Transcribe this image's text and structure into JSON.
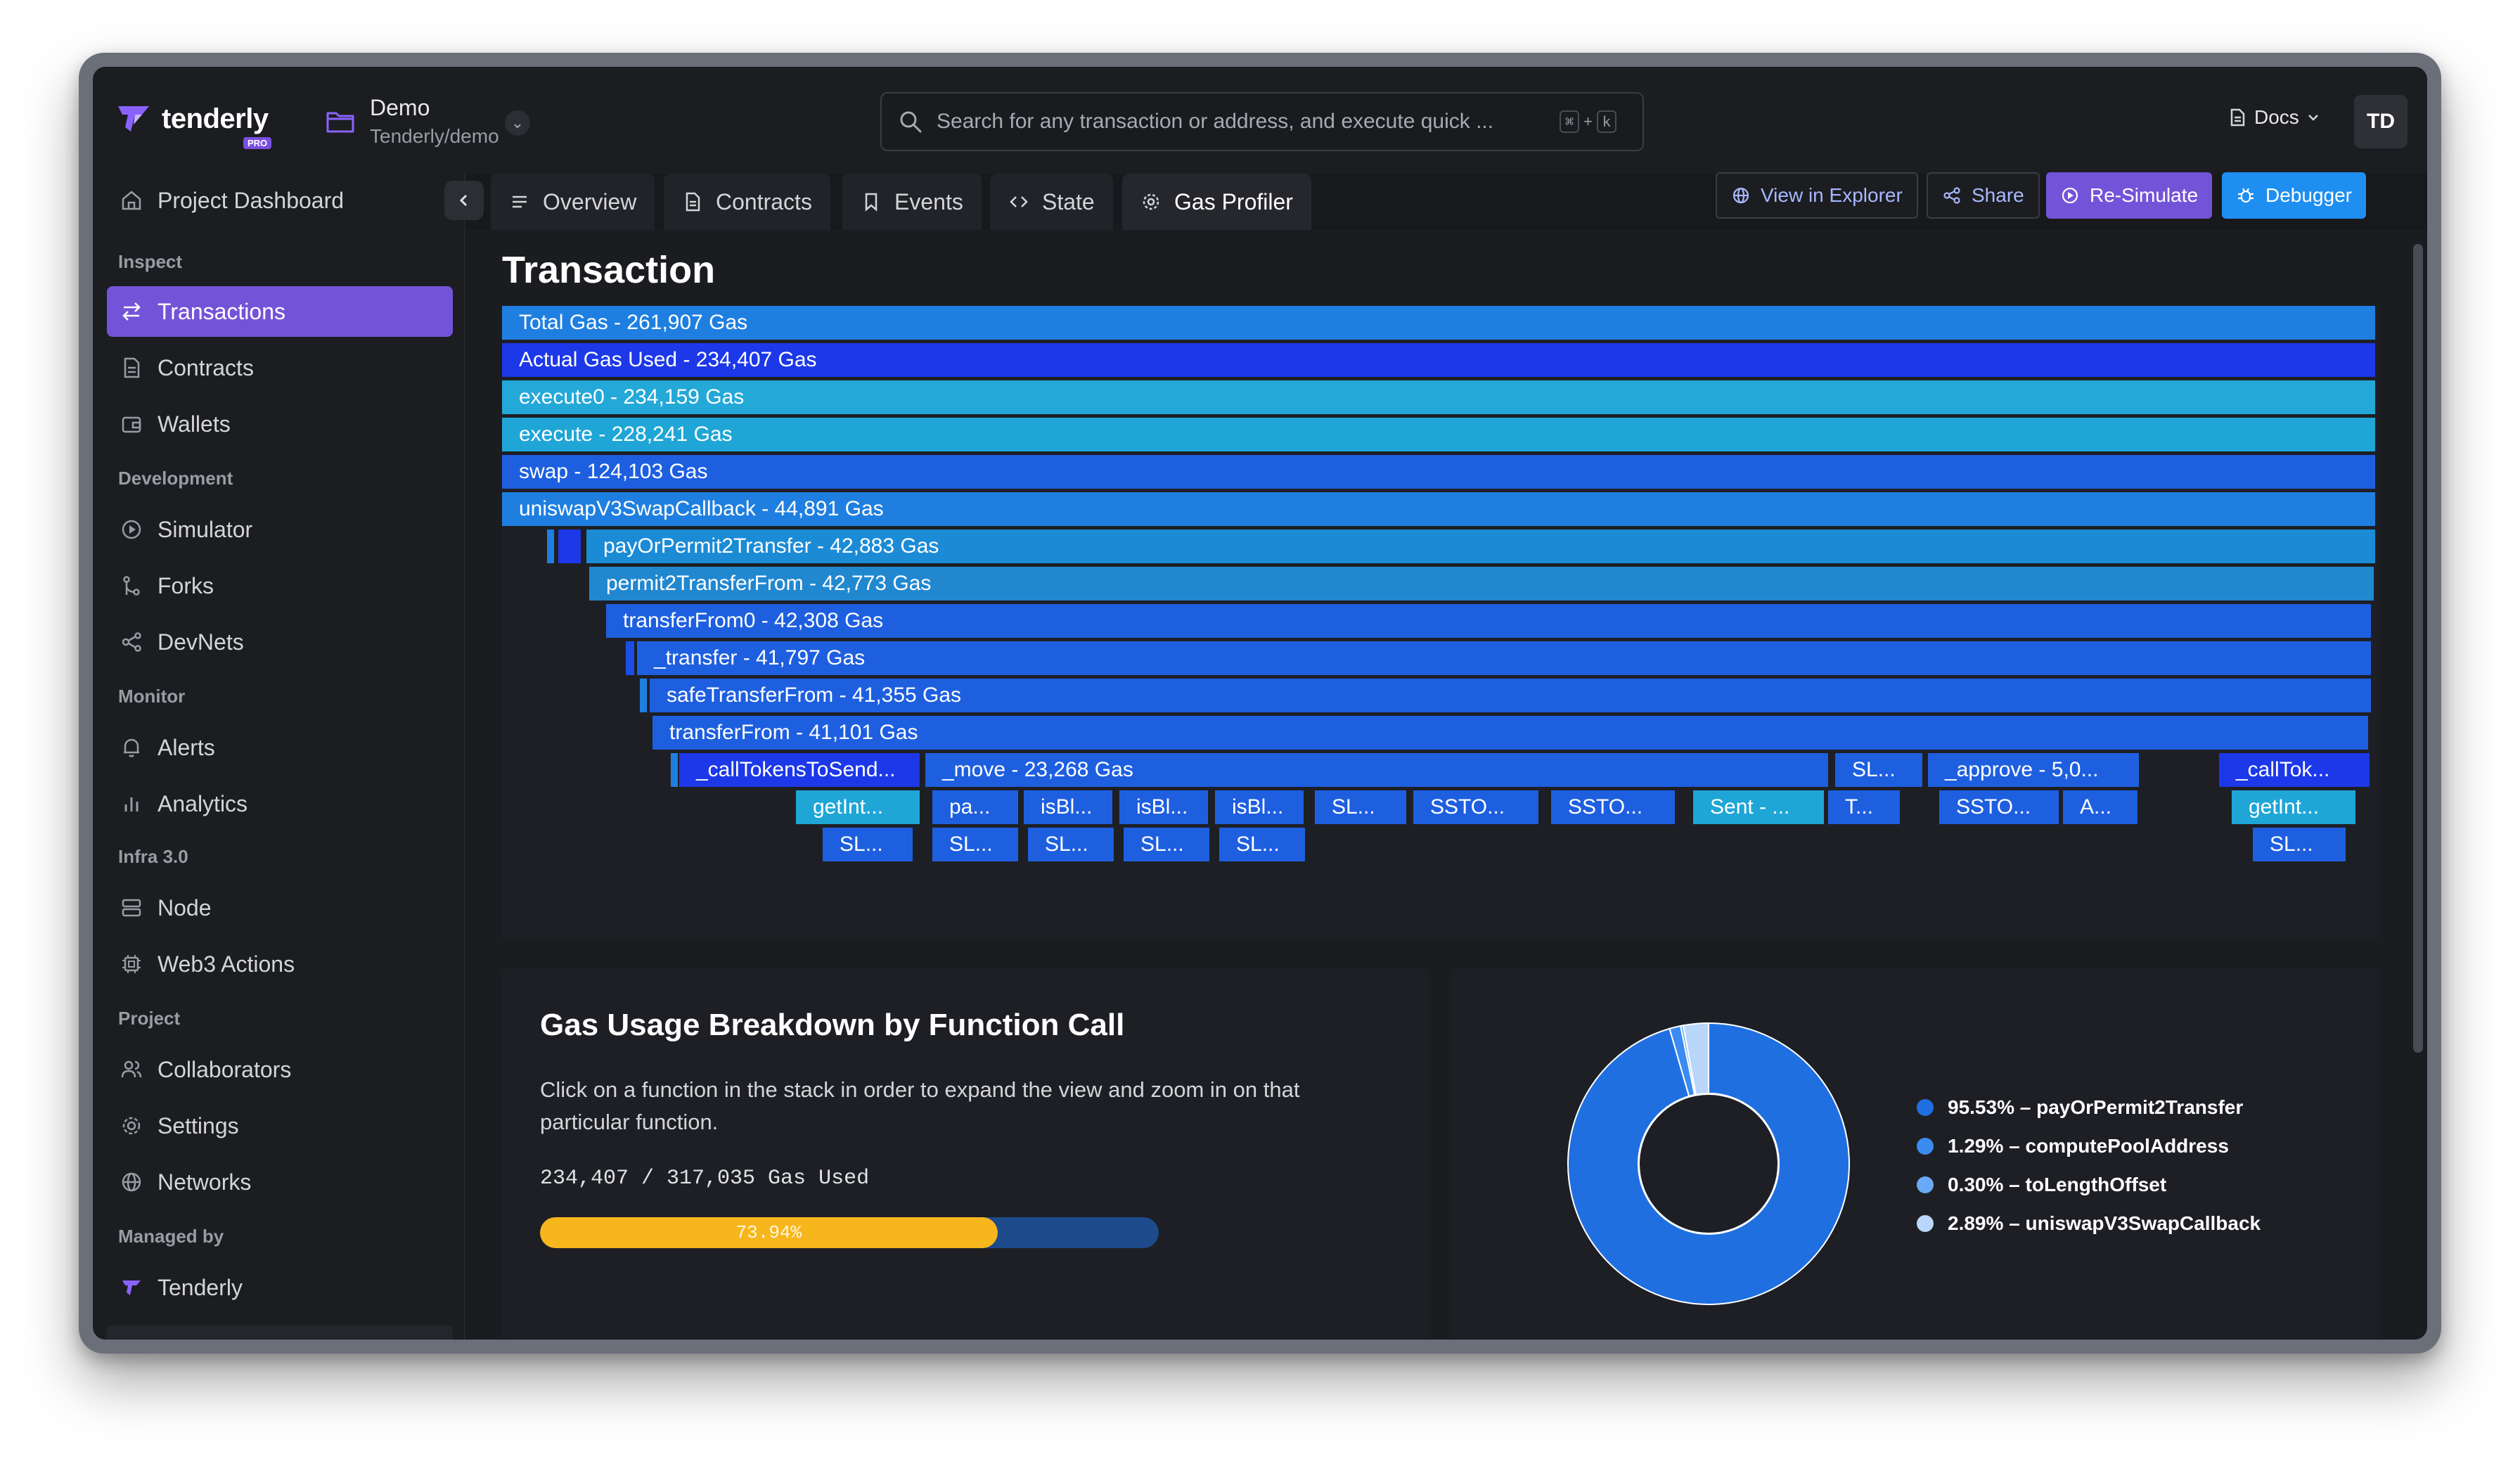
{
  "brand": {
    "name": "tenderly",
    "badge": "PRO"
  },
  "project": {
    "name": "Demo",
    "slug": "Tenderly/demo"
  },
  "search": {
    "placeholder": "Search for any transaction or address, and execute quick ...",
    "shortcut_mod": "⌘",
    "shortcut_plus": "+",
    "shortcut_key": "k"
  },
  "header": {
    "docs_label": "Docs",
    "avatar_initials": "TD"
  },
  "sidebar": {
    "dashboard": "Project Dashboard",
    "sections": {
      "inspect": "Inspect",
      "development": "Development",
      "monitor": "Monitor",
      "infra": "Infra 3.0",
      "project": "Project",
      "managed": "Managed by"
    },
    "items": {
      "transactions": "Transactions",
      "contracts": "Contracts",
      "wallets": "Wallets",
      "simulator": "Simulator",
      "forks": "Forks",
      "devnets": "DevNets",
      "alerts": "Alerts",
      "analytics": "Analytics",
      "node": "Node",
      "web3_actions": "Web3 Actions",
      "collaborators": "Collaborators",
      "settings": "Settings",
      "networks": "Networks",
      "tenderly": "Tenderly"
    }
  },
  "tabs": {
    "overview": "Overview",
    "contracts": "Contracts",
    "events": "Events",
    "state": "State",
    "gas_profiler": "Gas Profiler"
  },
  "actions": {
    "view_explorer": "View in Explorer",
    "share": "Share",
    "resimulate": "Re-Simulate",
    "debugger": "Debugger"
  },
  "page": {
    "title": "Transaction"
  },
  "flame": {
    "r0": "Total Gas - 261,907 Gas",
    "r1": "Actual Gas Used - 234,407 Gas",
    "r2": "execute0 - 234,159 Gas",
    "r3": "execute - 228,241 Gas",
    "r4": "swap - 124,103 Gas",
    "r5": "uniswapV3SwapCallback - 44,891 Gas",
    "r6": "payOrPermit2Transfer - 42,883 Gas",
    "r7": "permit2TransferFrom - 42,773 Gas",
    "r8": "transferFrom0 - 42,308 Gas",
    "r9": "_transfer - 41,797 Gas",
    "r10": "safeTransferFrom - 41,355 Gas",
    "r11": "transferFrom - 41,101 Gas",
    "r12": [
      "_callTokensToSend...",
      "_move - 23,268 Gas",
      "SL...",
      "_approve - 5,0...",
      "_callTok..."
    ],
    "r13": [
      "getInt...",
      "pa...",
      "isBl...",
      "isBl...",
      "isBl...",
      "SL...",
      "SSTO...",
      "SSTO...",
      "Sent - ...",
      "T...",
      "SSTO...",
      "A...",
      "getInt..."
    ],
    "r14": [
      "SL...",
      "SL...",
      "SL...",
      "SL...",
      "SL...",
      "SL..."
    ]
  },
  "breakdown": {
    "title": "Gas Usage Breakdown by Function Call",
    "description": "Click on a function in the stack in order to expand the view and zoom in on that particular function.",
    "gas_used_text": "234,407 / 317,035 Gas Used",
    "progress_percent": 73.94,
    "progress_label": "73.94%"
  },
  "donut": {
    "slices": [
      {
        "label": "95.53% – payOrPermit2Transfer",
        "value": 95.53,
        "color": "#1f6fe0"
      },
      {
        "label": "1.29% – computePoolAddress",
        "value": 1.29,
        "color": "#3b8cf0"
      },
      {
        "label": "0.30% – toLengthOffset",
        "value": 0.3,
        "color": "#6aa9f5"
      },
      {
        "label": "2.89% – uniswapV3SwapCallback",
        "value": 2.89,
        "color": "#b9d7fb"
      }
    ]
  },
  "colors": {
    "accent_purple": "#7354d8",
    "accent_blue": "#1f8ef1",
    "progress_yellow": "#f6b61c"
  }
}
